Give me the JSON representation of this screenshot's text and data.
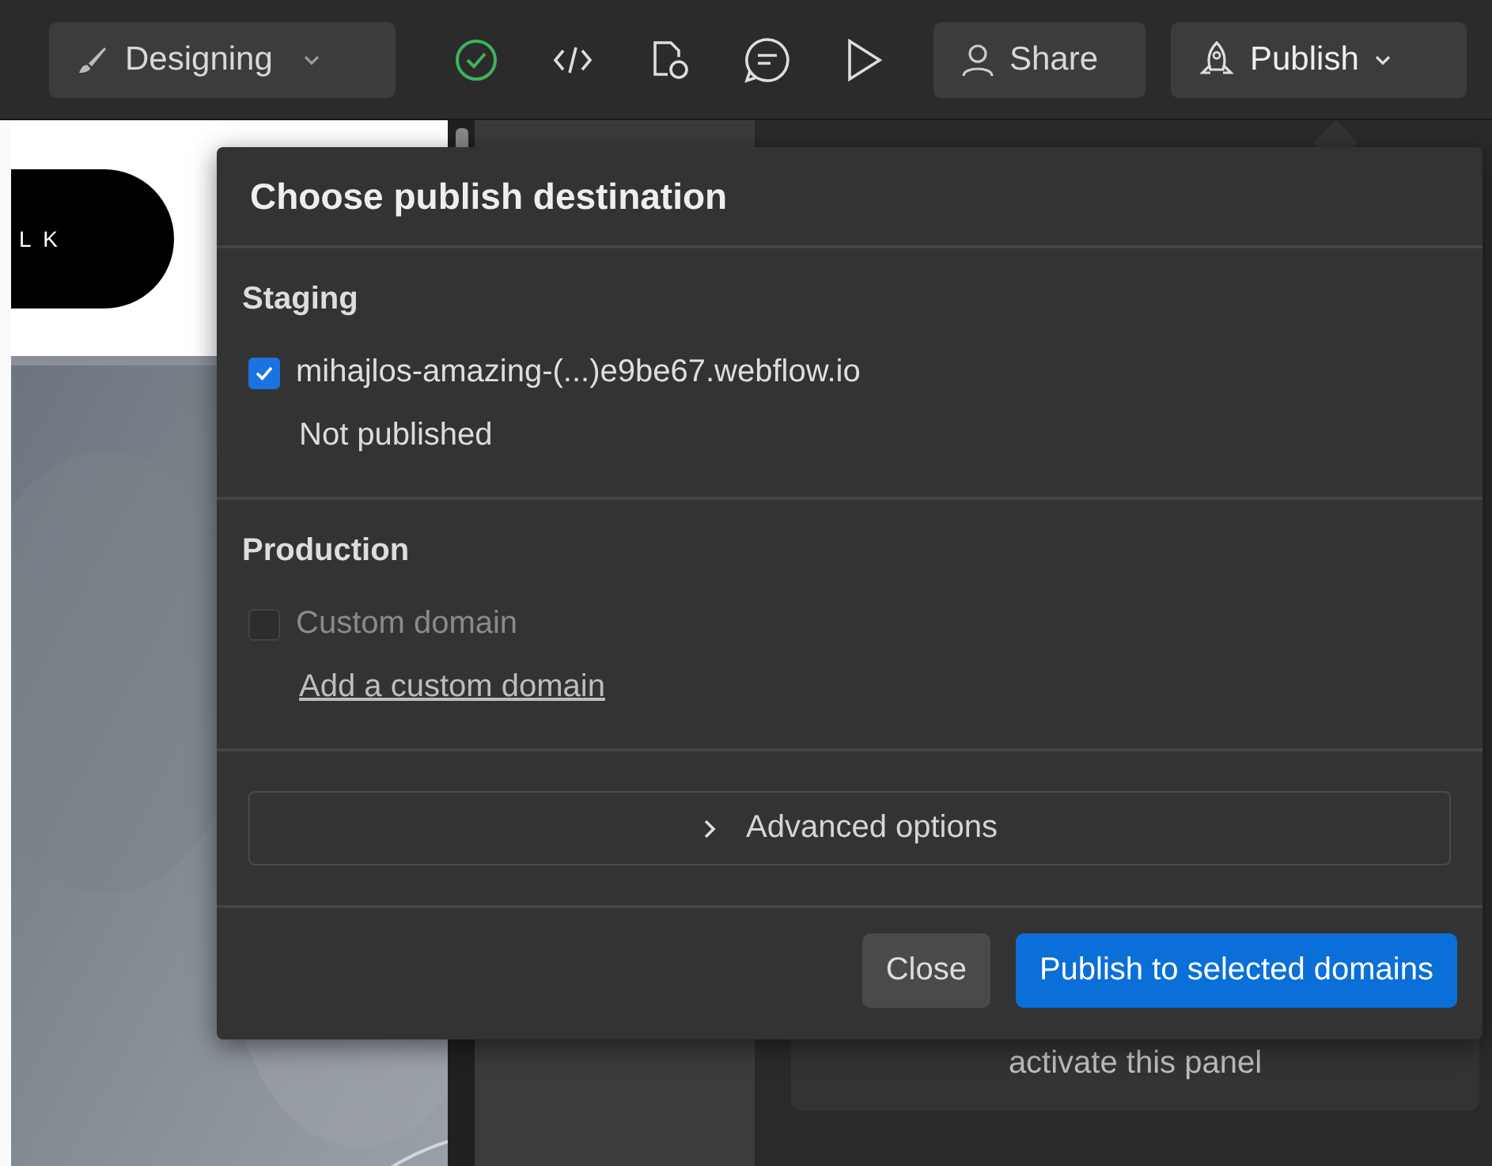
{
  "toolbar": {
    "mode_button": {
      "label": "Designing"
    },
    "share_button": {
      "label": "Share"
    },
    "publish_button": {
      "label": "Publish"
    }
  },
  "canvas": {
    "pill_text": "L K"
  },
  "publish_dialog": {
    "title": "Choose publish destination",
    "sections": [
      {
        "heading": "Staging",
        "domains": [
          {
            "label": "mihajlos-amazing-(...)e9be67.webflow.io",
            "checked": true,
            "disabled": false,
            "status": "Not published"
          }
        ]
      },
      {
        "heading": "Production",
        "domains": [
          {
            "label": "Custom domain",
            "checked": false,
            "disabled": true,
            "link": "Add a custom domain"
          }
        ]
      }
    ],
    "advanced": {
      "label": "Advanced options",
      "expanded": false
    },
    "buttons": [
      {
        "label": "Close",
        "kind": "secondary"
      },
      {
        "label": "Publish to selected domains",
        "kind": "primary"
      }
    ]
  },
  "side_panel": {
    "message": "activate this panel"
  }
}
